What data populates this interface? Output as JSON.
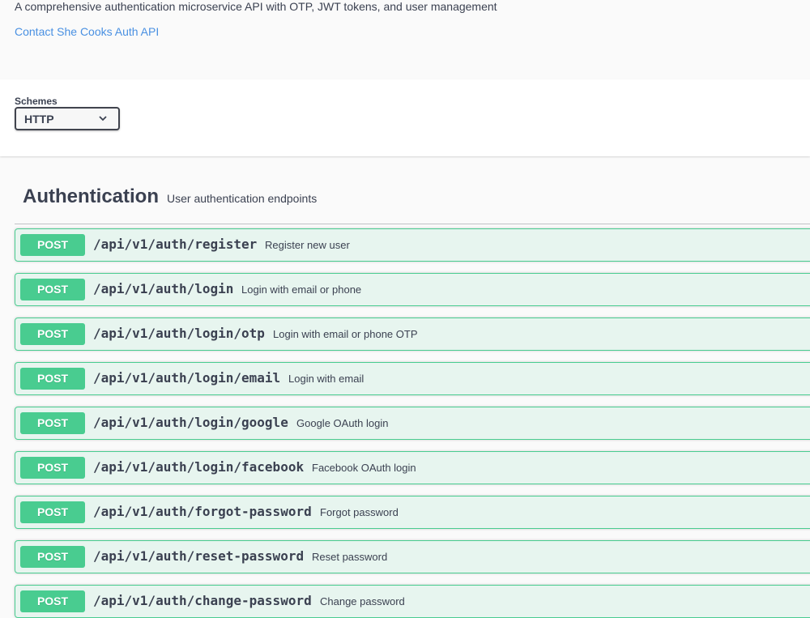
{
  "info": {
    "description": "A comprehensive authentication microservice API with OTP, JWT tokens, and user management",
    "contact_link": "Contact She Cooks Auth API"
  },
  "schemes": {
    "label": "Schemes",
    "selected": "HTTP"
  },
  "tag": {
    "name": "Authentication",
    "description": "User authentication endpoints"
  },
  "operations": [
    {
      "method": "POST",
      "path": "/api/v1/auth/register",
      "summary": "Register new user"
    },
    {
      "method": "POST",
      "path": "/api/v1/auth/login",
      "summary": "Login with email or phone"
    },
    {
      "method": "POST",
      "path": "/api/v1/auth/login/otp",
      "summary": "Login with email or phone OTP"
    },
    {
      "method": "POST",
      "path": "/api/v1/auth/login/email",
      "summary": "Login with email"
    },
    {
      "method": "POST",
      "path": "/api/v1/auth/login/google",
      "summary": "Google OAuth login"
    },
    {
      "method": "POST",
      "path": "/api/v1/auth/login/facebook",
      "summary": "Facebook OAuth login"
    },
    {
      "method": "POST",
      "path": "/api/v1/auth/forgot-password",
      "summary": "Forgot password"
    },
    {
      "method": "POST",
      "path": "/api/v1/auth/reset-password",
      "summary": "Reset password"
    },
    {
      "method": "POST",
      "path": "/api/v1/auth/change-password",
      "summary": "Change password"
    }
  ],
  "colors": {
    "post_accent": "#49cc90",
    "link": "#4990e2",
    "text": "#3b4151"
  }
}
